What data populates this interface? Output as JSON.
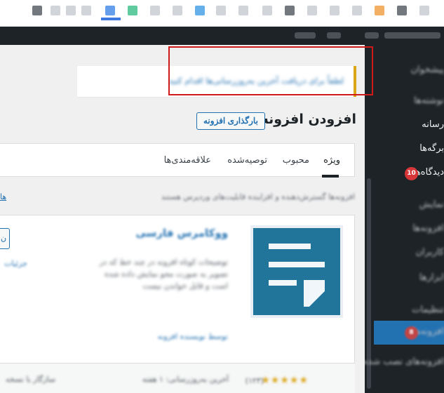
{
  "browser": {
    "bookmark_icons": [
      "bookmark-icon",
      "bookmark-icon",
      "bookmark-icon",
      "bookmark-icon",
      "bookmark-icon",
      "bookmark-icon",
      "bookmark-icon",
      "bookmark-icon",
      "bookmark-icon",
      "bookmark-icon",
      "bookmark-icon",
      "bookmark-icon",
      "bookmark-icon",
      "bookmark-icon",
      "bookmark-icon",
      "bookmark-icon",
      "bookmark-icon",
      "bookmark-icon",
      "bookmark-icon",
      "bookmark-icon",
      "bookmark-icon"
    ]
  },
  "sidebar": {
    "items": [
      {
        "label": "پیشخوان",
        "blurred": true
      },
      {
        "label": "نوشته‌ها",
        "blurred": true
      },
      {
        "label": "رسانه",
        "blurred": false
      },
      {
        "label": "برگه‌ها",
        "blurred": false
      },
      {
        "label": "دیدگاه‌ها",
        "blurred": false,
        "badge": "10"
      },
      {
        "label": "نمایش",
        "blurred": true
      },
      {
        "label": "افزونه‌ها",
        "blurred": true
      },
      {
        "label": "کاربران",
        "blurred": true
      },
      {
        "label": "ابزارها",
        "blurred": true
      },
      {
        "label": "تنظیمات",
        "blurred": true
      },
      {
        "label": "افزونه‌ها",
        "blurred": true,
        "current": true,
        "badge": "8"
      },
      {
        "label": "افزونه‌های نصب شده",
        "blurred": true
      }
    ]
  },
  "notice": {
    "text": "لطفاً برای دریافت آخرین به‌روزرسانی‌ها اقدام کنید"
  },
  "header": {
    "title": "افزودن افزونه",
    "upload_label": "بارگذاری افزونه"
  },
  "tabs": [
    {
      "label": "ویژه",
      "active": true
    },
    {
      "label": "محبوب",
      "active": false
    },
    {
      "label": "توصیه‌شده",
      "active": false
    },
    {
      "label": "علاقه‌مندی‌ها",
      "active": false
    }
  ],
  "info_strip": {
    "text": "افزونه‌ها گسترش‌دهنده و افزاینده قابلیت‌های وردپرس هستند",
    "link": "ها"
  },
  "card": {
    "name": "ووکامرس فارسی",
    "description": "توضیحات کوتاه افزونه در چند خط که در تصویر به صورت محو نمایش داده شده است و قابل خواندن نیست",
    "author": "توسط نویسنده افزونه",
    "install_label": "ن",
    "more_label": "جزئیات",
    "stars": "★★★★★",
    "rating_count": "(۱۲۳)",
    "compat": "آخرین به‌روزرسانی: ۱ هفته",
    "updated": "سازگار با نسخه"
  },
  "colors": {
    "accent": "#2271b1",
    "highlight": "#d01919",
    "warning": "#dba617",
    "adminbar": "#1d2327"
  }
}
